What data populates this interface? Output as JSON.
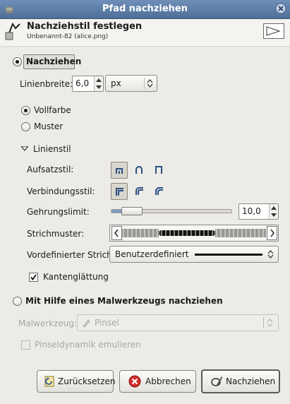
{
  "window": {
    "title": "Pfad nachziehen"
  },
  "header": {
    "title": "Nachziehstil festlegen",
    "subtitle": "Unbenannt-82 (alice.png)"
  },
  "stroke_outline": {
    "label": "Nachziehen",
    "line_width_label": "Linienbreite:",
    "line_width_value": "6,0",
    "unit": "px",
    "fill_options": [
      {
        "label": "Vollfarbe",
        "selected": true
      },
      {
        "label": "Muster",
        "selected": false
      }
    ],
    "line_style": {
      "expander_label": "Linienstil",
      "cap_style_label": "Aufsatzstil:",
      "join_style_label": "Verbindungsstil:",
      "miter_limit_label": "Gehrungslimit:",
      "miter_limit_value": "10,0",
      "miter_limit_level": 0.1,
      "dash_pattern_label": "Strichmuster:",
      "dash_preset_label": "Vordefinierter Strich:",
      "dash_preset_value": "Benutzerdefiniert",
      "antialias_label": "Kantenglättung",
      "antialias_checked": true
    }
  },
  "paint_tool_option": {
    "label": "Mit Hilfe eines Malwerkzeugs nachziehen",
    "paint_tool_label": "Malwerkzeug:",
    "paint_tool_value": "Pinsel",
    "emulate_dynamics_label": "Pinseldynamik emulieren"
  },
  "buttons": {
    "reset": "Zurücksetzen",
    "cancel": "Abbrechen",
    "stroke": "Nachziehen"
  },
  "colors": {
    "titlebar": "#5e7fab",
    "accent": "#7a9bc4",
    "window_bg": "#ecebe7"
  }
}
